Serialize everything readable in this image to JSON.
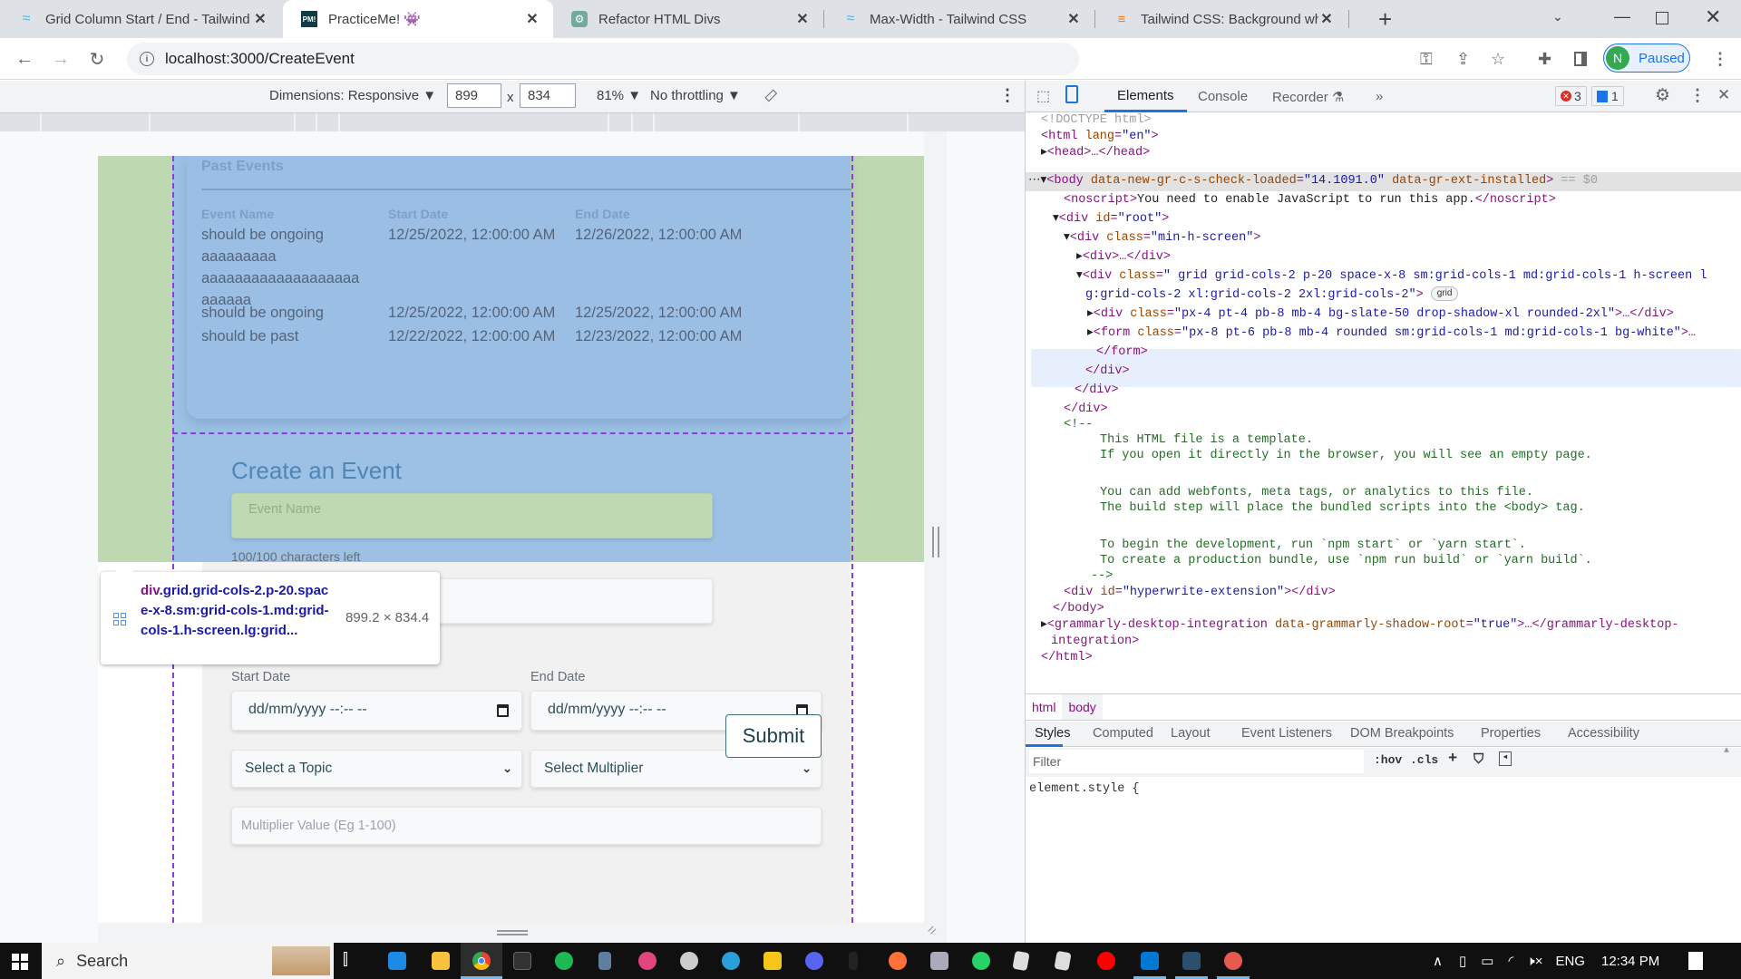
{
  "browser": {
    "tabs": [
      {
        "title": "Grid Column Start / End - Tailwind",
        "favicon": "tailwind-icon",
        "active": false
      },
      {
        "title": "PracticeMe! 👾",
        "favicon": "practiceme-icon",
        "active": true
      },
      {
        "title": "Refactor HTML Divs",
        "favicon": "chatgpt-icon",
        "active": false
      },
      {
        "title": "Max-Width - Tailwind CSS",
        "favicon": "tailwind-icon",
        "active": false
      },
      {
        "title": "Tailwind CSS: Background white",
        "favicon": "stackoverflow-icon",
        "active": false
      }
    ],
    "new_tab": "+",
    "url": "localhost:3000/CreateEvent",
    "profile_initial": "N",
    "profile_status": "Paused"
  },
  "device_toolbar": {
    "dimensions_label": "Dimensions: Responsive ▼",
    "width": "899",
    "times": "x",
    "height": "834",
    "zoom": "81% ▼",
    "throttling": "No throttling ▼"
  },
  "page": {
    "past_events": {
      "title": "Past Events",
      "columns": [
        "Event Name",
        "Start Date",
        "End Date"
      ],
      "rows": [
        {
          "name_lines": [
            "should be ongoing",
            "aaaaaaaaa",
            "aaaaaaaaaaaaaaaaaaa",
            "aaaaaa"
          ],
          "start": "12/25/2022, 12:00:00 AM",
          "end": "12/26/2022, 12:00:00 AM"
        },
        {
          "name_lines": [
            "should be ongoing"
          ],
          "start": "12/25/2022, 12:00:00 AM",
          "end": "12/25/2022, 12:00:00 AM"
        },
        {
          "name_lines": [
            "should be past"
          ],
          "start": "12/22/2022, 12:00:00 AM",
          "end": "12/23/2022, 12:00:00 AM"
        }
      ]
    },
    "create_event": {
      "title": "Create an Event",
      "event_name_placeholder": "Event Name",
      "chars_left": "100/100 characters left",
      "start_date_label": "Start Date",
      "end_date_label": "End Date",
      "date_placeholder": "dd/mm/yyyy --:-- --",
      "topic_select": "Select a Topic",
      "multiplier_select": "Select Multiplier",
      "multiplier_value_placeholder": "Multiplier Value (Eg 1-100)",
      "submit": "Submit"
    }
  },
  "inspect_tooltip": {
    "tag": "div",
    "selector": ".grid.grid-cols-2.p-20.space-x-8.sm:grid-cols-1.md:grid-cols-1.h-screen.lg:grid...",
    "size": "899.2 × 834.4"
  },
  "devtools": {
    "tabs": [
      "Elements",
      "Console",
      "Recorder ⚗",
      "»"
    ],
    "active_tab": "Elements",
    "errors": "3",
    "messages": "1",
    "dom_lines": {
      "doctype": "<!DOCTYPE html>",
      "html_open": "<html lang=\"en\">",
      "head": "<head>…</head>",
      "body_attr1": "data-new-gr-c-s-check-loaded",
      "body_val1": "\"14.1091.0\"",
      "body_attr2": "data-gr-ext-installed",
      "body_ref": "== $0",
      "noscript": "You need to enable JavaScript to run this app.",
      "root_id": "\"root\"",
      "minh_class": "\"min-h-screen\"",
      "collapsed_div": "<div>…</div>",
      "grid_class_1": "\" grid grid-cols-2 p-20 space-x-8 sm:grid-cols-1 md:grid-cols-1 h-screen l",
      "grid_class_2": "g:grid-cols-2 xl:grid-cols-2 2xl:grid-cols-2\"",
      "grid_badge": "grid",
      "child_div_class": "\"px-4 pt-4 pb-8 mb-4 bg-slate-50 drop-shadow-xl rounded-2xl\"",
      "child_form_class": "\"px-8 pt-6 pb-8 mb-4 rounded sm:grid-cols-1 md:grid-cols-1 bg-white\"",
      "comment_lines": [
        "This HTML file is a template.",
        "If you open it directly in the browser, you will see an empty page.",
        "",
        "You can add webfonts, meta tags, or analytics to this file.",
        "The build step will place the bundled scripts into the <body> tag.",
        "",
        "To begin the development, run `npm start` or `yarn start`.",
        "To create a production bundle, use `npm run build` or `yarn build`."
      ],
      "hyperwrite_id": "\"hyperwrite-extension\"",
      "grammarly_attr": "data-grammarly-shadow-root",
      "grammarly_val": "\"true\""
    },
    "breadcrumbs": [
      "html",
      "body"
    ],
    "style_tabs": [
      "Styles",
      "Computed",
      "Layout",
      "Event Listeners",
      "DOM Breakpoints",
      "Properties",
      "Accessibility"
    ],
    "filter_placeholder": "Filter",
    "hov": ":hov",
    "cls": ".cls",
    "element_style": "element.style {"
  },
  "taskbar": {
    "search": "Search",
    "lang": "ENG",
    "time": "12:34 PM"
  }
}
